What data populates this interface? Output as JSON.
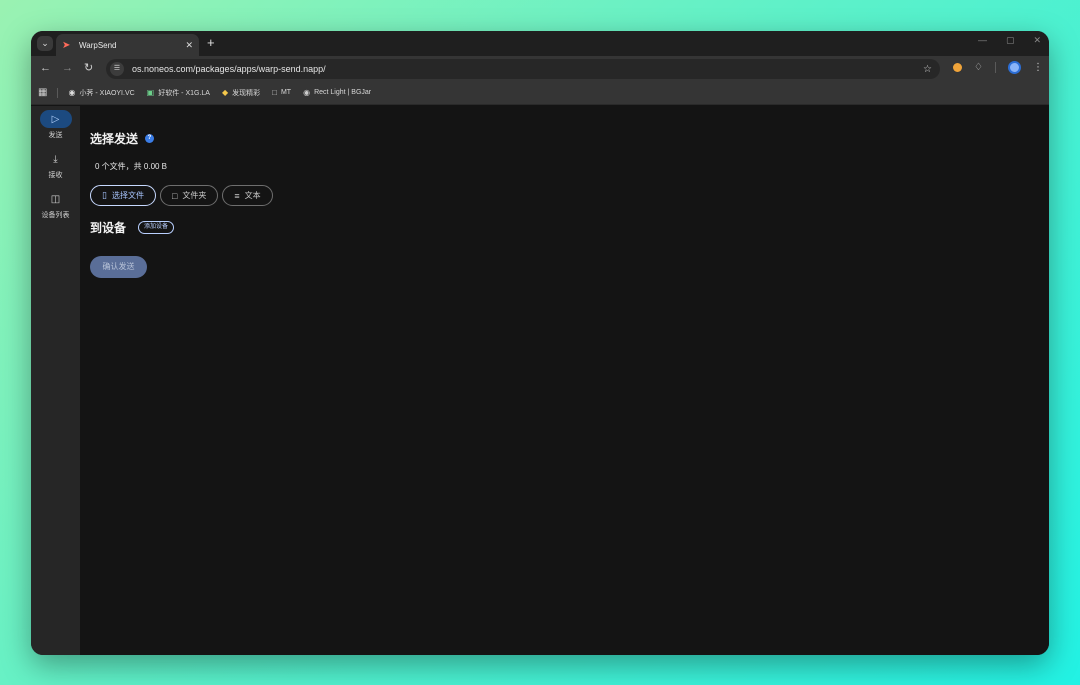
{
  "browser": {
    "tab_title": "WarpSend",
    "url": "os.noneos.com/packages/apps/warp-send.napp/",
    "bookmarks": [
      {
        "label": "小荠 - XIAOYI.VC",
        "icon": "xiaoyi-icon"
      },
      {
        "label": "好软件 - X1G.LA",
        "icon": "x1g-icon"
      },
      {
        "label": "发现精彩",
        "icon": "discover-icon"
      },
      {
        "label": "MT",
        "icon": "folder-icon"
      },
      {
        "label": "Rect Light | BGJar",
        "icon": "bgjar-icon"
      }
    ]
  },
  "sidebar": {
    "items": [
      {
        "label": "发送",
        "icon": "send-icon",
        "active": true
      },
      {
        "label": "接收",
        "icon": "download-icon",
        "active": false
      },
      {
        "label": "设备列表",
        "icon": "devices-icon",
        "active": false
      }
    ]
  },
  "main": {
    "title": "选择发送",
    "file_summary": "0 个文件，共 0.00 B",
    "buttons": {
      "select_file": "选择文件",
      "folder": "文件夹",
      "text": "文本"
    },
    "device_title": "到设备",
    "add_device": "添加设备",
    "confirm": "确认发送"
  },
  "colors": {
    "accent": "#1c4a80",
    "confirm_bg": "#5a6e98"
  }
}
